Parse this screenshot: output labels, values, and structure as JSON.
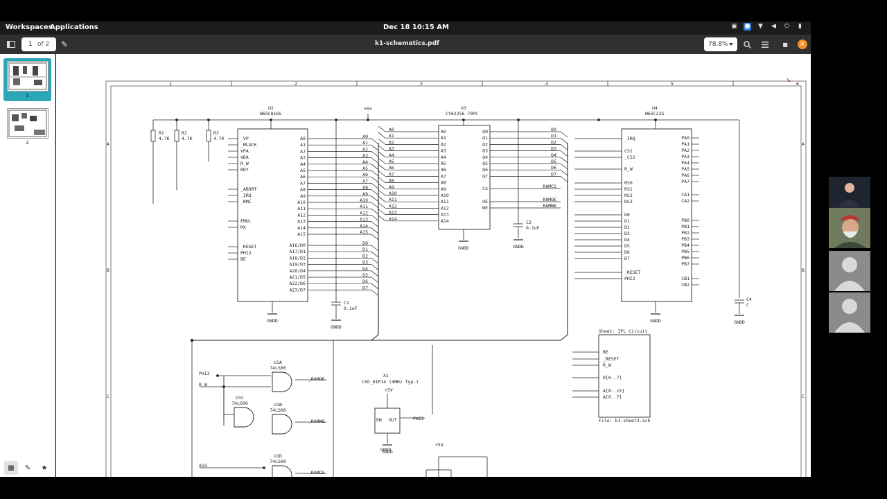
{
  "topbar": {
    "workspaces": "Workspaces",
    "applications": "Applications",
    "clock": "Dec 18  10:15 AM"
  },
  "viewer": {
    "page_current": "1",
    "page_total": "of 2",
    "filename": "k1-schematics.pdf",
    "zoom": "78.8%",
    "thumbs": [
      "1",
      "2"
    ]
  },
  "colors": {
    "accent": "#2aa6b8",
    "close": "#f28c28",
    "header": "#303030",
    "topbar": "#1c1c1c"
  },
  "schematic": {
    "columns": [
      "1",
      "2",
      "3",
      "4",
      "5",
      "6"
    ],
    "rows": [
      "A",
      "B",
      "C"
    ],
    "u2": {
      "ref": "U2",
      "part": "W65C816S"
    },
    "u3": {
      "ref": "U3",
      "part": "CY62256-70PC"
    },
    "u4": {
      "ref": "U4",
      "part": "W65C22S"
    },
    "vcc_label": "+5V",
    "gnd_label": "GNDD",
    "resistors": [
      {
        "ref": "R1",
        "value": "4.7K"
      },
      {
        "ref": "R2",
        "value": "4.7K"
      },
      {
        "ref": "R3",
        "value": "4.7K"
      }
    ],
    "caps": [
      {
        "ref": "C1",
        "value": "0.1uF"
      },
      {
        "ref": "C2",
        "value": "0.1uF"
      },
      {
        "ref": "C4",
        "value": "C"
      }
    ],
    "u2_left_pins": [
      "_VP",
      "_MLOCK",
      "VPA",
      "VDA",
      "R_W",
      "RDY",
      "_ABORT",
      "_IRQ",
      "_NMI",
      "EMUL",
      "MX",
      "_RESET",
      "PHI2",
      "BE"
    ],
    "u2_addr": [
      "A0",
      "A1",
      "A2",
      "A3",
      "A4",
      "A5",
      "A6",
      "A7",
      "A8",
      "A9",
      "A10",
      "A11",
      "A12",
      "A13",
      "A14",
      "A15"
    ],
    "u2_data": [
      "A16/D0",
      "A17/D1",
      "A18/D2",
      "A19/D3",
      "A20/D4",
      "A21/D5",
      "A22/D6",
      "A23/D7"
    ],
    "u3_left": [
      "A0",
      "A1",
      "A2",
      "A3",
      "A4",
      "A5",
      "A6",
      "A7",
      "A8",
      "A9",
      "A10",
      "A11",
      "A12",
      "A13",
      "A14"
    ],
    "u3_right": [
      "Q0",
      "Q1",
      "Q2",
      "Q3",
      "Q4",
      "Q5",
      "Q6",
      "Q7"
    ],
    "u3_ctrl": [
      "CS",
      "OE",
      "WE"
    ],
    "u3_ctrl_nets": [
      "_RAMCS",
      "_RAMOE",
      "_RAMWE"
    ],
    "u4_left": [
      "_IRQ",
      "CS1",
      "_CS2",
      "R_W",
      "RS0",
      "RS1",
      "RS2",
      "RS3",
      "D0",
      "D1",
      "D2",
      "D3",
      "D4",
      "D5",
      "D6",
      "D7",
      "_RESET",
      "PHI2"
    ],
    "u4_right": [
      "PA0",
      "PA1",
      "PA2",
      "PA3",
      "PA4",
      "PA5",
      "PA6",
      "PA7",
      "CA1",
      "CA2",
      "PB0",
      "PB1",
      "PB2",
      "PB3",
      "PB4",
      "PB5",
      "PB6",
      "PB7",
      "CB1",
      "CB2"
    ],
    "sheet_title": "Sheet: IPL Circuit",
    "sheet_file": "File: k1-sheet2.sch",
    "sheet_pins": [
      "BE",
      "_RESET",
      "R_W",
      "D[0..7]",
      "A[8..15]",
      "A[0..7]"
    ],
    "x1": {
      "ref": "X1",
      "part": "CXO_DIP14 (4MHz Typ.)",
      "pins": [
        "EN",
        "OUT"
      ]
    },
    "gates": [
      {
        "ref": "U1A",
        "part": "74LS00",
        "out": "_RAMOE"
      },
      {
        "ref": "U1C",
        "part": "74LS00",
        "out": ""
      },
      {
        "ref": "U1B",
        "part": "74LS00",
        "out": "_RAMWE"
      },
      {
        "ref": "U1D",
        "part": "74LS00",
        "out": "_RAMCS"
      }
    ],
    "nets": {
      "phi2": "PHI2",
      "rw": "R_W",
      "a15": "A15",
      "reset": "_RESET",
      "be": "BE",
      "irq": "_IRQ"
    }
  }
}
